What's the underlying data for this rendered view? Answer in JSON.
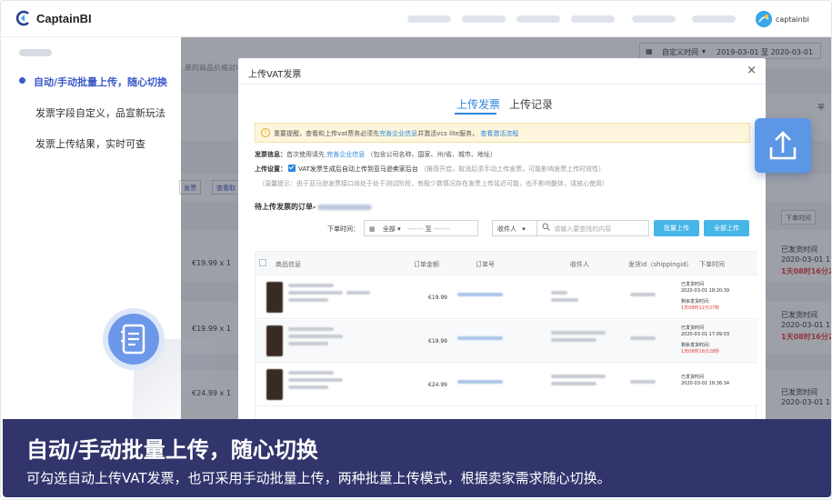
{
  "header": {
    "brand": "CaptainBI",
    "user_name": "captainbi"
  },
  "sidebar": {
    "items": [
      {
        "label": "自动/手动批量上传，随心切换",
        "active": true
      },
      {
        "label": "发票字段自定义，品宣新玩法",
        "active": false
      },
      {
        "label": "发票上传结果，实时可查",
        "active": false
      }
    ]
  },
  "background_app": {
    "date_filter_label": "自定义时间",
    "date_range": "2019-03-01 至 2020-03-01",
    "hint_fragment": "单的商品价格对以",
    "actions": [
      "发票",
      "查看取"
    ],
    "order_time_select": "下单时间",
    "right_label": "平",
    "rows": [
      {
        "price": "€19.99 x 1",
        "status": "已发货时间",
        "date": "2020-03-01 17:",
        "remaining": "1天08时16分2"
      },
      {
        "price": "€19.99 x 1",
        "status": "已发货时间",
        "date": "2020-03-01 17:",
        "remaining": "1天08时16分2"
      },
      {
        "price": "€24.99 x 1",
        "status": "已发货时间",
        "date": "2020-03-01 18:",
        "remaining": ""
      }
    ]
  },
  "modal": {
    "title": "上传VAT发票",
    "close_symbol": "×",
    "tabs": [
      "上传发票",
      "上传记录"
    ],
    "active_tab": 0,
    "notice_prefix": "重要提醒，查看和上传vat票务必须先",
    "notice_link1": "完善企业信息",
    "notice_middle": "并激活vcs lite服务，",
    "notice_link2": "查看激活流程",
    "invoice_info_label": "发票信息：",
    "invoice_info_text": "首次使用请先",
    "invoice_info_link": "完善企业信息",
    "invoice_info_suffix": "（包含公司名称、国家、州/省、城市、地址）",
    "upload_setting_label": "上传设置：",
    "upload_setting_text": "VAT发票生成后自动上传到亚马逊卖家后台",
    "upload_setting_hint": "（推荐开启，取消后须手动上传发票，可能影响发票上传时效性）",
    "tip_text": "（温馨提示：由于亚马逊发票接口尚处于处于测试阶段，有极少数情况存在发票上传延迟可能，也不影响整体，请放心使用）",
    "pending_label": "待上传发票的订单-",
    "filters": {
      "order_time_label": "下单时间：",
      "all_option": "全部",
      "date_from": "-------",
      "date_sep": "至",
      "date_to": "-------",
      "receiver_select": "收件人",
      "search_placeholder": "请输入要查找的内容",
      "batch_upload_button": "批量上传",
      "upload_all_button": "全部上传"
    },
    "table": {
      "headers": [
        "商品信息",
        "订单金额",
        "订单号",
        "收件人",
        "发货id（shippingid）",
        "下单时间"
      ],
      "rows": [
        {
          "amount": "€19.99",
          "status": "已发货时间",
          "date": "2020-03-01 18:20:39",
          "remaining_label": "剩余发货时间：",
          "remaining": "1天08时12分27秒"
        },
        {
          "amount": "€19.99",
          "status": "已发货时间",
          "date": "2020-03-01 17:09:03",
          "remaining_label": "剩余发货时间：",
          "remaining": "1天08时16分28秒"
        },
        {
          "amount": "€24.99",
          "status": "已发货时间",
          "date": "2020-03-01 18:36:34",
          "remaining_label": "",
          "remaining": ""
        }
      ]
    }
  },
  "caption": {
    "title": "自动/手动批量上传，随心切换",
    "subtitle": "可勾选自动上传VAT发票，也可采用手动批量上传，两种批量上传模式，根据卖家需求随心切换。"
  },
  "colors": {
    "accent_blue": "#3d59c9",
    "tab_blue": "#2e86de",
    "button_blue": "#46b6e8",
    "caption_bg": "#1f245f",
    "alert_red": "#e33b3b"
  },
  "icons": [
    "captainbi-logo-icon",
    "user-avatar-icon",
    "calendar-icon",
    "search-icon",
    "warning-icon",
    "document-list-icon",
    "upload-icon",
    "close-icon",
    "chevron-down-icon"
  ]
}
